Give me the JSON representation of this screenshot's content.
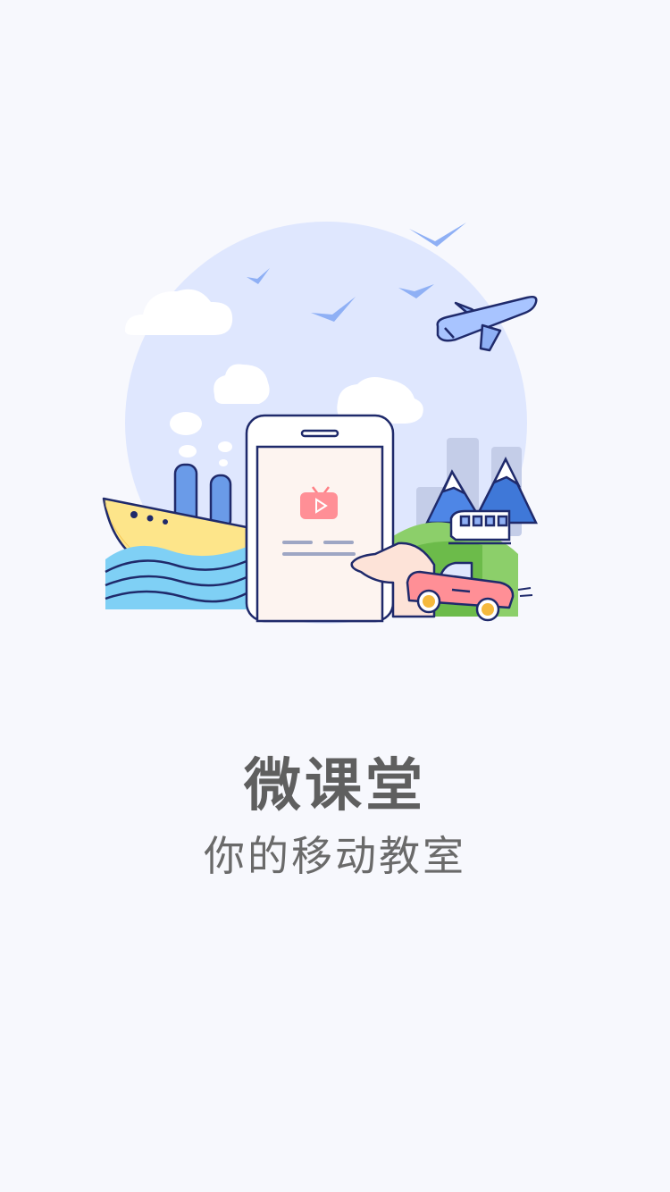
{
  "app": {
    "title": "微课堂",
    "subtitle": "你的移动教室"
  },
  "illustration": {
    "icons": [
      "sky-circle",
      "cloud-icon",
      "bird-icon",
      "airplane-icon",
      "ship-icon",
      "wave-icon",
      "phone-icon",
      "video-play-icon",
      "hand-icon",
      "car-icon",
      "train-icon",
      "mountain-icon",
      "building-icon"
    ]
  },
  "colors": {
    "background": "#f7f8fd",
    "sky": "#dfe8ff",
    "outline": "#1f2a6b",
    "accent_red": "#ff7f85",
    "title_text": "#5f5f5f"
  }
}
